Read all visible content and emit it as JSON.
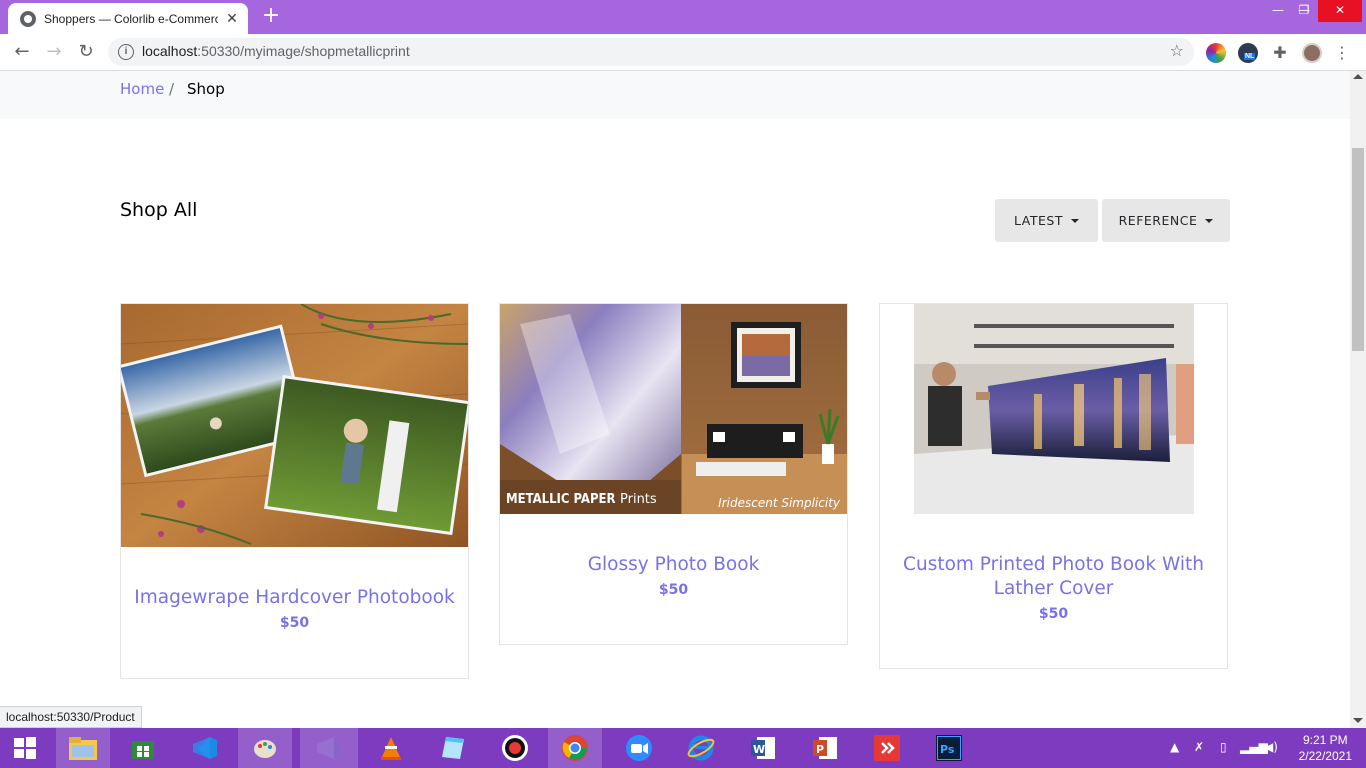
{
  "browser": {
    "tab_title": "Shoppers — Colorlib e-Commerce",
    "tab_close": "✕",
    "new_tab": "+",
    "url_host": "localhost",
    "url_path": ":50330/myimage/shopmetallicprint",
    "ext_badge": "NL",
    "window_controls": {
      "minimize": "—",
      "restore": "❐",
      "close": "✕"
    }
  },
  "breadcrumb": {
    "home": "Home",
    "separator": "/",
    "current": "Shop"
  },
  "shop": {
    "title": "Shop All",
    "sort_latest": "LATEST",
    "sort_reference": "REFERENCE"
  },
  "products": [
    {
      "name": "Imagewrape Hardcover Photobook",
      "price": "$50"
    },
    {
      "name": "Glossy Photo Book",
      "price": "$50"
    },
    {
      "name": "Custom Printed Photo Book With Lather Cover",
      "price": "$50"
    }
  ],
  "product_images": {
    "metallic_caption_left": "METALLIC PAPER",
    "metallic_caption_left_b": "Prints",
    "metallic_caption_right": "Iridescent Simplicity"
  },
  "status_bar": "localhost:50330/Product",
  "taskbar": {
    "time": "9:21 PM",
    "date": "2/22/2021"
  },
  "colors": {
    "titlebar": "#a666dd",
    "taskbar": "#7d3cc0",
    "accent": "#7971ea"
  }
}
